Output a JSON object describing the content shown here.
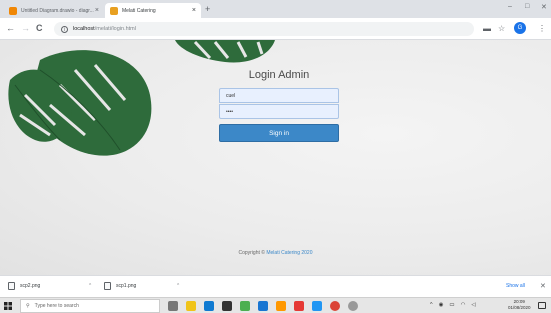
{
  "tabs": [
    {
      "label": "Untitled Diagram.drawio - diagr...",
      "favicon_color": "#f08705"
    },
    {
      "label": "Melati Catering",
      "favicon_color": "#e8a021"
    }
  ],
  "new_tab": "+",
  "tab_close": "×",
  "window_controls": {
    "minimize": "–",
    "maximize": "□",
    "close": "✕"
  },
  "toolbar": {
    "back": "←",
    "forward": "→",
    "reload": "C",
    "url_host": "localhost",
    "url_path": "/melati/login.html",
    "avatar_letter": "G"
  },
  "login": {
    "title": "Login Admin",
    "username_value": "cuel",
    "password_value": "••••",
    "signin_label": "Sign in"
  },
  "footer": {
    "copyright_prefix": "Copyright © ",
    "brand": "Melati Catering 2020"
  },
  "downloads": {
    "items": [
      {
        "name": "scp2.png"
      },
      {
        "name": "scp1.png"
      }
    ],
    "show_all": "Show all",
    "close": "✕"
  },
  "taskbar": {
    "search_placeholder": "Type here to search",
    "clock_time": "20:09",
    "clock_date": "01/08/2020"
  }
}
